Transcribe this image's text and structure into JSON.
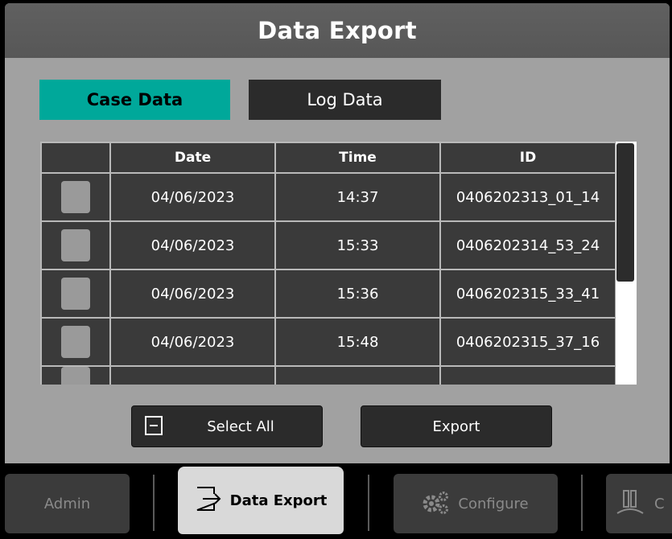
{
  "title": "Data Export",
  "tabs": [
    {
      "label": "Case Data",
      "active": true
    },
    {
      "label": "Log Data",
      "active": false
    }
  ],
  "table": {
    "headers": [
      "",
      "Date",
      "Time",
      "ID"
    ],
    "rows": [
      {
        "date": "04/06/2023",
        "time": "14:37",
        "id": "0406202313_01_14"
      },
      {
        "date": "04/06/2023",
        "time": "15:33",
        "id": "0406202314_53_24"
      },
      {
        "date": "04/06/2023",
        "time": "15:36",
        "id": "0406202315_33_41"
      },
      {
        "date": "04/06/2023",
        "time": "15:48",
        "id": "0406202315_37_16"
      }
    ]
  },
  "buttons": {
    "select_all": "Select All",
    "export": "Export"
  },
  "nav": {
    "admin": "Admin",
    "data_export": "Data Export",
    "configure": "Configure",
    "last": "C"
  },
  "colors": {
    "accent": "#00a89a",
    "panel": "#a1a1a1",
    "dark": "#2b2b2b"
  }
}
